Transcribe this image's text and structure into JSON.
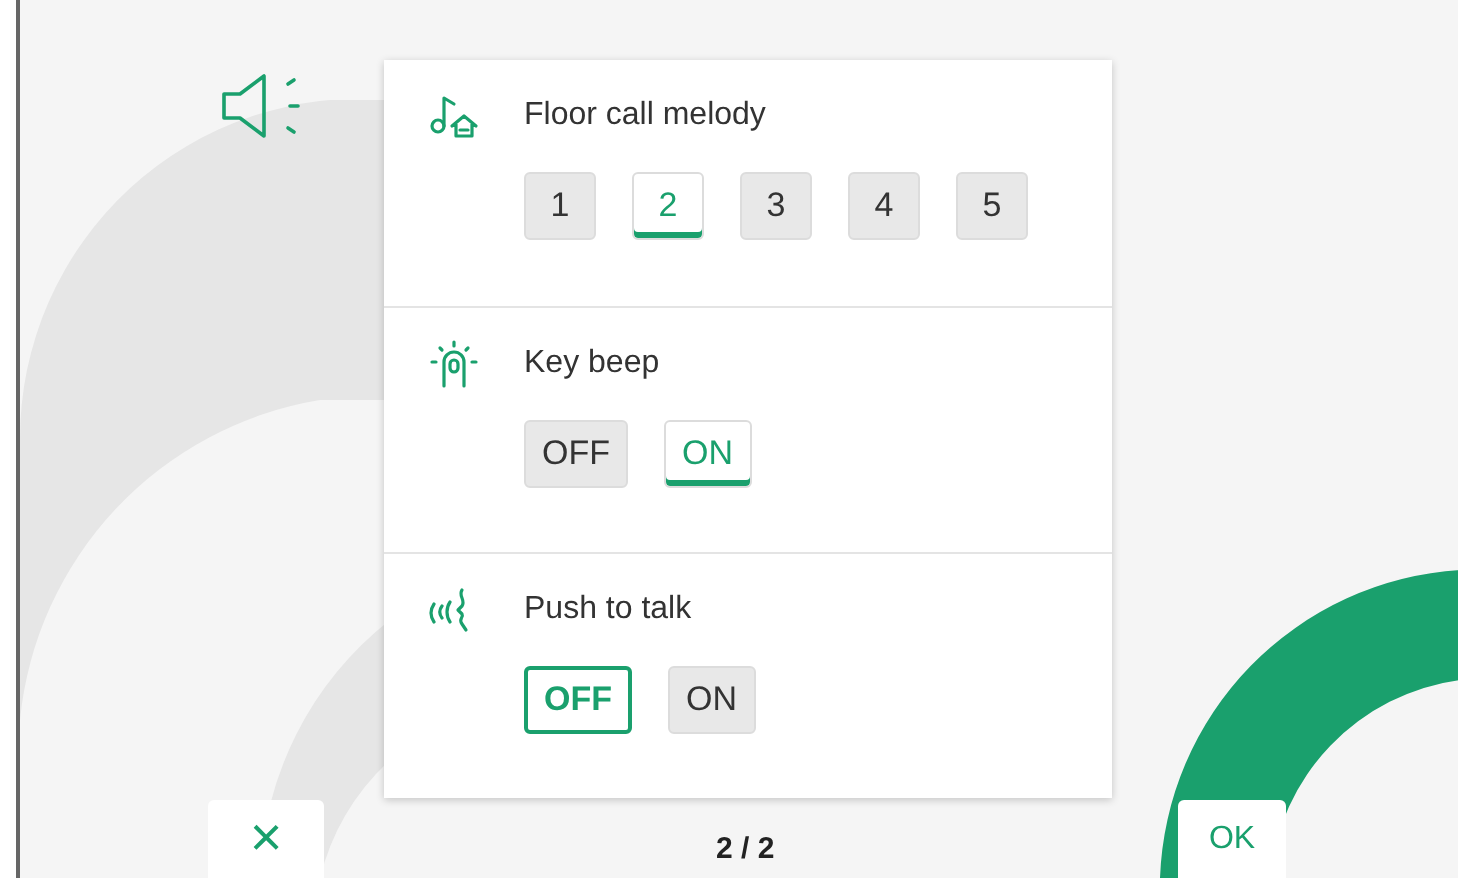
{
  "sections": [
    {
      "kind": "melody",
      "title": "Floor call melody",
      "options": [
        {
          "label": "1",
          "selected": false,
          "focused": false
        },
        {
          "label": "2",
          "selected": true,
          "focused": false
        },
        {
          "label": "3",
          "selected": false,
          "focused": false
        },
        {
          "label": "4",
          "selected": false,
          "focused": false
        },
        {
          "label": "5",
          "selected": false,
          "focused": false
        }
      ]
    },
    {
      "kind": "beep",
      "title": "Key beep",
      "options": [
        {
          "label": "OFF",
          "selected": false,
          "focused": false
        },
        {
          "label": "ON",
          "selected": true,
          "focused": false
        }
      ]
    },
    {
      "kind": "talk",
      "title": "Push to talk",
      "options": [
        {
          "label": "OFF",
          "selected": false,
          "focused": true
        },
        {
          "label": "ON",
          "selected": false,
          "focused": false
        }
      ]
    }
  ],
  "footer": {
    "cancel": "×",
    "page": "2 / 2",
    "ok": "OK"
  }
}
